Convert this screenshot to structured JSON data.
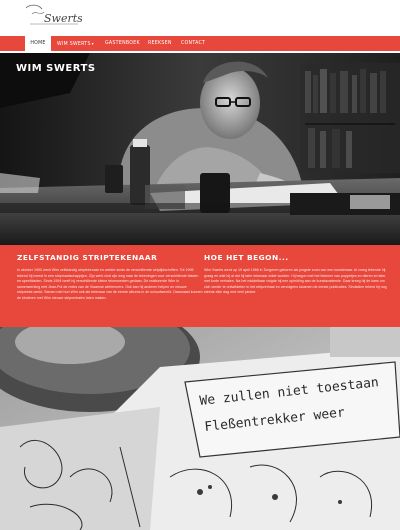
{
  "logo": {
    "text": "Swerts"
  },
  "nav": {
    "items": [
      {
        "label": "HOME",
        "active": true
      },
      {
        "label": "WIM SWERTS",
        "has_dropdown": true
      },
      {
        "label": "GASTENBOEK"
      },
      {
        "label": "REEKSEN"
      },
      {
        "label": "CONTACT"
      }
    ]
  },
  "hero": {
    "title": "WIM SWERTS"
  },
  "sections": {
    "left": {
      "title": "ZELFSTANDIG STRIPTEKENAAR",
      "body": "In oktober 1990 werd Wim zelfstandig striptekenaar en werkte sinds de verschillende striptijdschriften. Tot 1995 tekend hij meest in een stripmaatschappijen. Zijn werk vind zijn weg naar de tekeningen voor verschillende bladen en speelbladen. Sinds 1994 heeft hij verschillende kleine tekenwerken gedaan. De realiseerde Wim in samenwerking met Jean-Pol de reeks van de Vlaamse wielrenners. Ook kan hij anderen helpen en nieuwe stripreeks werkt. Samen met hun Wim ook als tekenaar van de eerste albums in de schoolwereld. Daarnaast kunnen de kinderen met Wim nieuwe stripverhalen laten maken."
    },
    "right": {
      "title": "HOE HET BEGON...",
      "body": "Wim Swerts werd op 19 april 1966 in Tongeren geboren als jongste zoon van een kunstenaar. Al vroeg tekende hij graag en wist hij al dat hij later tekenaar wilde worden. Hij begon met het tekenen van poppetjes en dieren en later met korte verhalen. Na het middelbaar volgde hij een opleiding aan de kunstacademie. Daar kreeg hij de kans om zich verder te ontwikkelen in het stripverhaal en vervolgens kwamen de eerste publicaties. Sindsdien tekent hij nog steeds elke dag met veel plezier."
    }
  },
  "photo2": {
    "comic_text": [
      "We zullen niet toestaan",
      "Fleßentrekker weer"
    ]
  },
  "colors": {
    "accent": "#e8473c",
    "nav_text": "#ffffff"
  }
}
